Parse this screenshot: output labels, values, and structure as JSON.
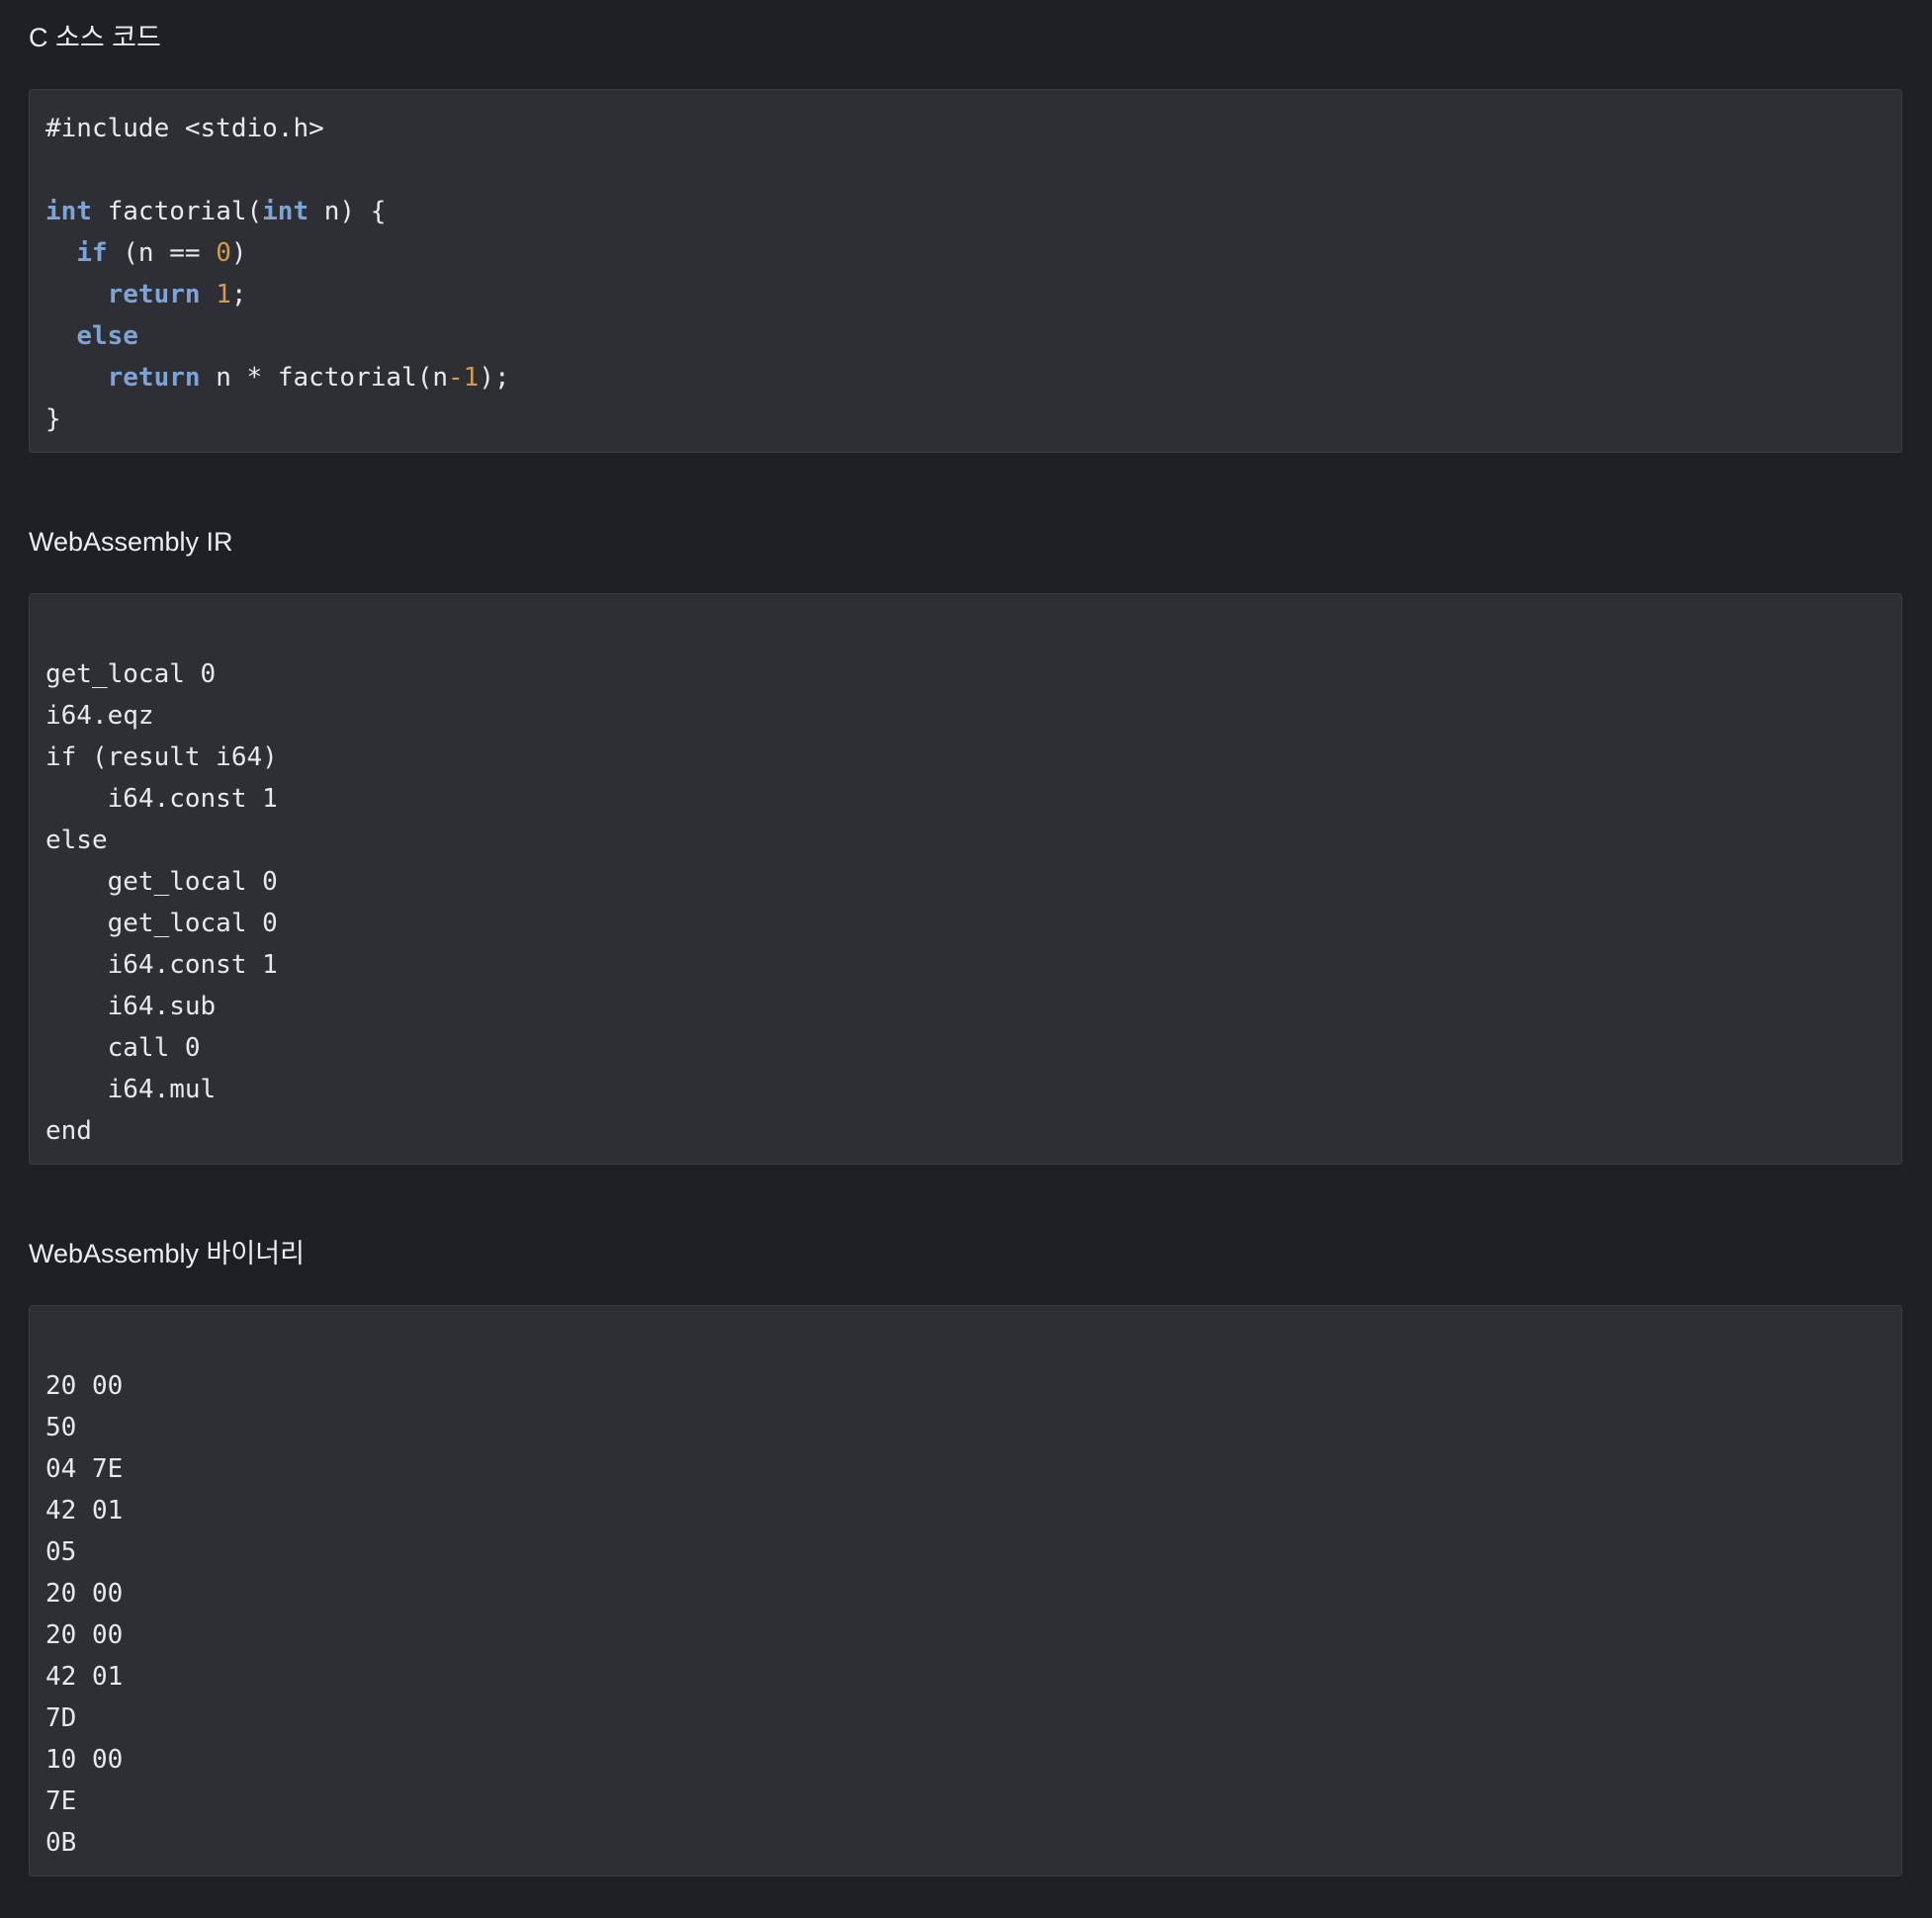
{
  "sections": [
    {
      "title": "C 소스 코드",
      "lines": [
        [
          {
            "t": "#include <stdio.h>",
            "c": ""
          }
        ],
        [
          {
            "t": "",
            "c": ""
          }
        ],
        [
          {
            "t": "int",
            "c": "kw"
          },
          {
            "t": " factorial(",
            "c": ""
          },
          {
            "t": "int",
            "c": "kw"
          },
          {
            "t": " n) {",
            "c": ""
          }
        ],
        [
          {
            "t": "  ",
            "c": ""
          },
          {
            "t": "if",
            "c": "kw"
          },
          {
            "t": " (n == ",
            "c": ""
          },
          {
            "t": "0",
            "c": "num"
          },
          {
            "t": ")",
            "c": ""
          }
        ],
        [
          {
            "t": "    ",
            "c": ""
          },
          {
            "t": "return",
            "c": "kw"
          },
          {
            "t": " ",
            "c": ""
          },
          {
            "t": "1",
            "c": "num"
          },
          {
            "t": ";",
            "c": ""
          }
        ],
        [
          {
            "t": "  ",
            "c": ""
          },
          {
            "t": "else",
            "c": "kw"
          }
        ],
        [
          {
            "t": "    ",
            "c": ""
          },
          {
            "t": "return",
            "c": "kw"
          },
          {
            "t": " n * factorial(n",
            "c": ""
          },
          {
            "t": "-1",
            "c": "num"
          },
          {
            "t": ");",
            "c": ""
          }
        ],
        [
          {
            "t": "}",
            "c": ""
          }
        ]
      ]
    },
    {
      "title": "WebAssembly IR",
      "lines": [
        [
          {
            "t": "",
            "c": ""
          }
        ],
        [
          {
            "t": "get_local 0",
            "c": ""
          }
        ],
        [
          {
            "t": "i64.eqz",
            "c": ""
          }
        ],
        [
          {
            "t": "if (result i64)",
            "c": ""
          }
        ],
        [
          {
            "t": "    i64.const 1",
            "c": ""
          }
        ],
        [
          {
            "t": "else",
            "c": ""
          }
        ],
        [
          {
            "t": "    get_local 0",
            "c": ""
          }
        ],
        [
          {
            "t": "    get_local 0",
            "c": ""
          }
        ],
        [
          {
            "t": "    i64.const 1",
            "c": ""
          }
        ],
        [
          {
            "t": "    i64.sub",
            "c": ""
          }
        ],
        [
          {
            "t": "    call 0",
            "c": ""
          }
        ],
        [
          {
            "t": "    i64.mul",
            "c": ""
          }
        ],
        [
          {
            "t": "end",
            "c": ""
          }
        ]
      ]
    },
    {
      "title": "WebAssembly 바이너리",
      "lines": [
        [
          {
            "t": "",
            "c": ""
          }
        ],
        [
          {
            "t": "20 00",
            "c": ""
          }
        ],
        [
          {
            "t": "50",
            "c": ""
          }
        ],
        [
          {
            "t": "04 7E",
            "c": ""
          }
        ],
        [
          {
            "t": "42 01",
            "c": ""
          }
        ],
        [
          {
            "t": "05",
            "c": ""
          }
        ],
        [
          {
            "t": "20 00",
            "c": ""
          }
        ],
        [
          {
            "t": "20 00",
            "c": ""
          }
        ],
        [
          {
            "t": "42 01",
            "c": ""
          }
        ],
        [
          {
            "t": "7D",
            "c": ""
          }
        ],
        [
          {
            "t": "10 00",
            "c": ""
          }
        ],
        [
          {
            "t": "7E",
            "c": ""
          }
        ],
        [
          {
            "t": "0B",
            "c": ""
          }
        ]
      ]
    }
  ],
  "colors": {
    "background": "#1f2025",
    "code_background": "#2e2f35",
    "keyword": "#7ea3d6",
    "number": "#d49a4e",
    "text": "#e8e9ea"
  }
}
